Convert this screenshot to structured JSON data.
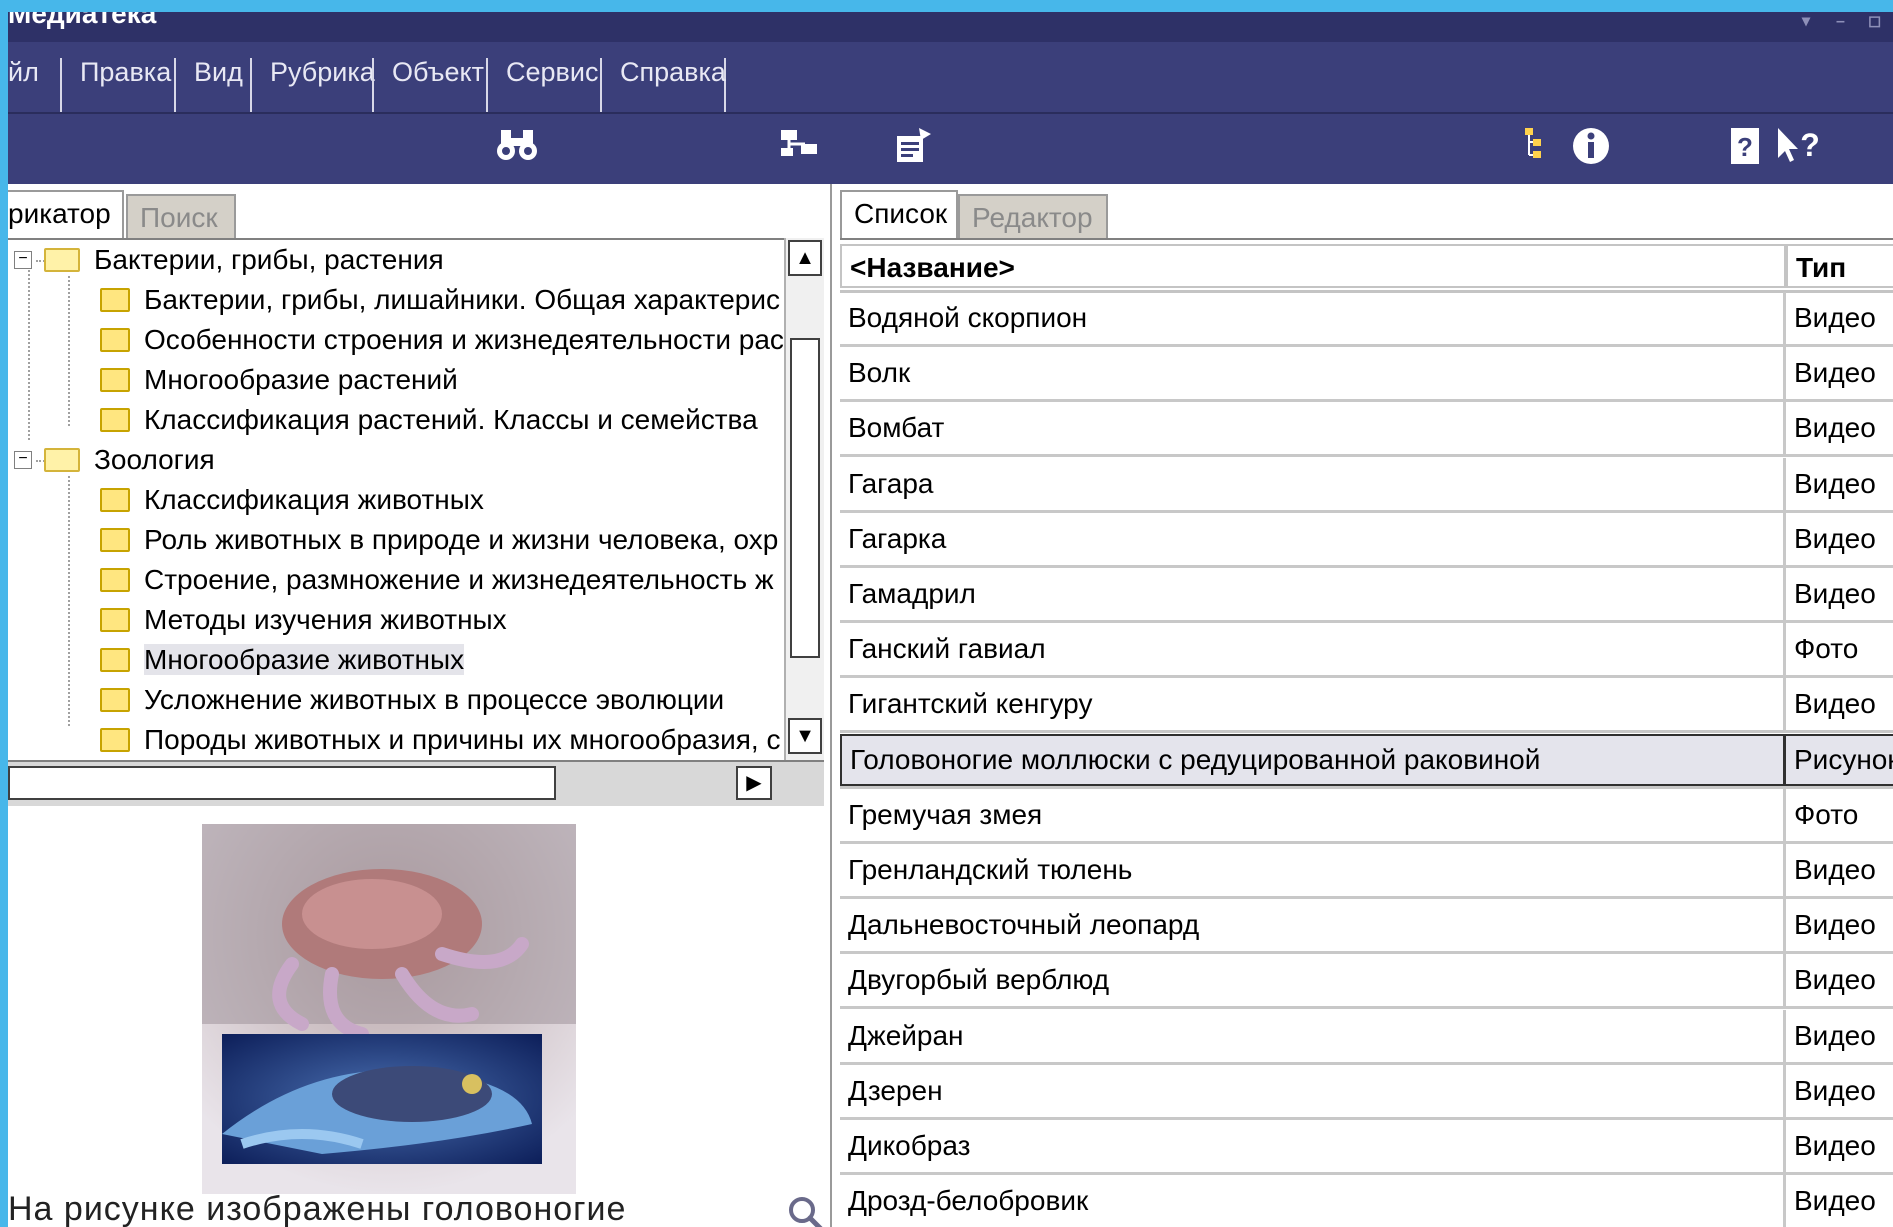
{
  "window": {
    "title": "Медиатека"
  },
  "menu": [
    "йл",
    "Правка",
    "Вид",
    "Рубрика",
    "Объект",
    "Сервис",
    "Справка"
  ],
  "toolbar": {
    "icons": [
      "binoculars-search-icon",
      "network-tree-icon",
      "properties-edit-icon",
      "tree-view-icon",
      "info-icon",
      "help-book-icon",
      "context-help-icon"
    ]
  },
  "left_tabs": [
    "рикатор",
    "Поиск"
  ],
  "tree": [
    {
      "label": "Бактерии, грибы, растения",
      "level": 0,
      "expanded": true
    },
    {
      "label": "Бактерии, грибы, лишайники. Общая характерис",
      "level": 1
    },
    {
      "label": "Особенности строения и жизнедеятельности рас",
      "level": 1
    },
    {
      "label": "Многообразие растений",
      "level": 1
    },
    {
      "label": "Классификация растений. Классы и семейства",
      "level": 1
    },
    {
      "label": "Зоология",
      "level": 0,
      "expanded": true
    },
    {
      "label": "Классификация животных",
      "level": 1
    },
    {
      "label": "Роль животных в природе и жизни человека, охр",
      "level": 1
    },
    {
      "label": "Строение, размножение и жизнедеятельность ж",
      "level": 1
    },
    {
      "label": "Методы изучения животных",
      "level": 1
    },
    {
      "label": "Многообразие животных",
      "level": 1,
      "selected": true
    },
    {
      "label": "Усложнение животных в процессе эволюции",
      "level": 1
    },
    {
      "label": "Породы животных и причины их многообразия, с",
      "level": 1
    }
  ],
  "caption": "На рисунке изображены головоногие",
  "right_tabs": [
    "Список",
    "Редактор"
  ],
  "columns": {
    "name": "<Название>",
    "type": "Тип"
  },
  "rows": [
    {
      "name": "Водяной скорпион",
      "type": "Видео"
    },
    {
      "name": "Волк",
      "type": "Видео"
    },
    {
      "name": "Вомбат",
      "type": "Видео"
    },
    {
      "name": "Гагара",
      "type": "Видео"
    },
    {
      "name": "Гагарка",
      "type": "Видео"
    },
    {
      "name": "Гамадрил",
      "type": "Видео"
    },
    {
      "name": "Ганский гавиал",
      "type": "Фото"
    },
    {
      "name": "Гигантский кенгуру",
      "type": "Видео"
    },
    {
      "name": "Головоногие моллюски с редуцированной раковиной",
      "type": "Рисунок",
      "selected": true
    },
    {
      "name": "Гремучая змея",
      "type": "Фото"
    },
    {
      "name": "Гренландский тюлень",
      "type": "Видео"
    },
    {
      "name": "Дальневосточный леопард",
      "type": "Видео"
    },
    {
      "name": "Двугорбый верблюд",
      "type": "Видео"
    },
    {
      "name": "Джейран",
      "type": "Видео"
    },
    {
      "name": "Дзерен",
      "type": "Видео"
    },
    {
      "name": "Дикобраз",
      "type": "Видео"
    },
    {
      "name": "Дрозд-белобровик",
      "type": "Видео"
    }
  ]
}
